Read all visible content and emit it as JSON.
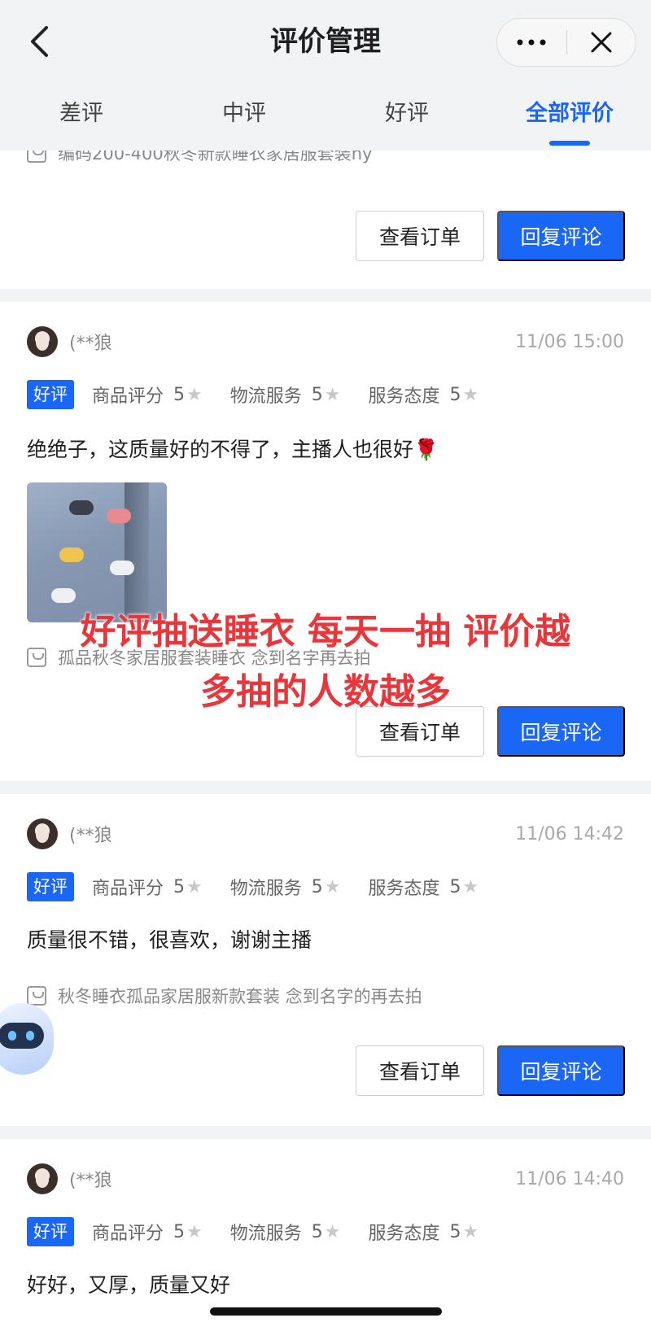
{
  "header": {
    "title": "评价管理"
  },
  "tabs": [
    {
      "label": "差评"
    },
    {
      "label": "中评"
    },
    {
      "label": "好评"
    },
    {
      "label": "全部评价",
      "active": true
    }
  ],
  "partial_top": {
    "product": "编码200-400秋冬新款睡衣家居服套装ny"
  },
  "buttons": {
    "view_order": "查看订单",
    "reply": "回复评论"
  },
  "rating_labels": {
    "badge": "好评",
    "goods": "商品评分",
    "logistics": "物流服务",
    "attitude": "服务态度"
  },
  "reviews": [
    {
      "user": "(**狼",
      "time": "11/06 15:00",
      "goods_score": "5",
      "logistics_score": "5",
      "attitude_score": "5",
      "comment": "绝绝子，这质量好的不得了，主播人也很好🌹",
      "product": "孤品秋冬家居服套装睡衣 念到名字再去拍",
      "has_photo": true
    },
    {
      "user": "(**狼",
      "time": "11/06 14:42",
      "goods_score": "5",
      "logistics_score": "5",
      "attitude_score": "5",
      "comment": "质量很不错，很喜欢，谢谢主播",
      "product": "秋冬睡衣孤品家居服新款套装 念到名字的再去拍"
    },
    {
      "user": "(**狼",
      "time": "11/06 14:40",
      "goods_score": "5",
      "logistics_score": "5",
      "attitude_score": "5",
      "comment": "好好，又厚，质量又好"
    }
  ],
  "overlay": {
    "line1": "好评抽送睡衣 每天一抽 评价越",
    "line2": "多抽的人数越多"
  },
  "colors": {
    "accent": "#1a66f5",
    "overlay_text": "#e8363b",
    "header_bg": "#f2f3f5"
  }
}
